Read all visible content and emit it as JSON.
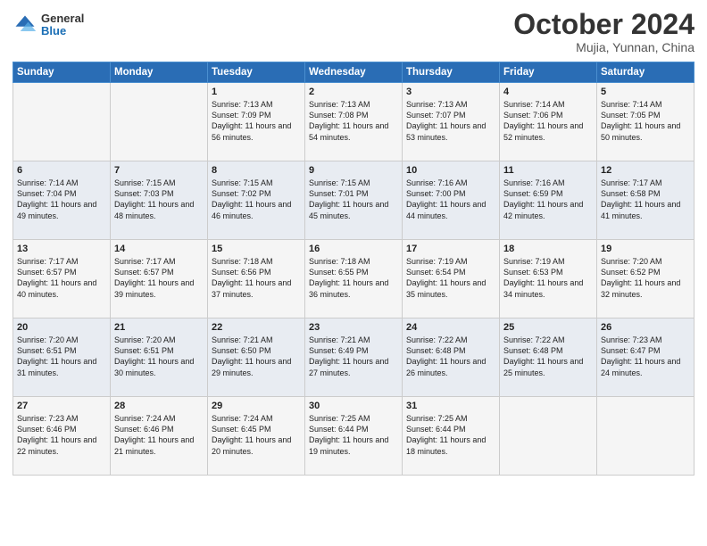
{
  "header": {
    "logo": {
      "general": "General",
      "blue": "Blue"
    },
    "title": "October 2024",
    "location": "Mujia, Yunnan, China"
  },
  "days_of_week": [
    "Sunday",
    "Monday",
    "Tuesday",
    "Wednesday",
    "Thursday",
    "Friday",
    "Saturday"
  ],
  "weeks": [
    [
      {
        "day": "",
        "sunrise": "",
        "sunset": "",
        "daylight": ""
      },
      {
        "day": "",
        "sunrise": "",
        "sunset": "",
        "daylight": ""
      },
      {
        "day": "1",
        "sunrise": "Sunrise: 7:13 AM",
        "sunset": "Sunset: 7:09 PM",
        "daylight": "Daylight: 11 hours and 56 minutes."
      },
      {
        "day": "2",
        "sunrise": "Sunrise: 7:13 AM",
        "sunset": "Sunset: 7:08 PM",
        "daylight": "Daylight: 11 hours and 54 minutes."
      },
      {
        "day": "3",
        "sunrise": "Sunrise: 7:13 AM",
        "sunset": "Sunset: 7:07 PM",
        "daylight": "Daylight: 11 hours and 53 minutes."
      },
      {
        "day": "4",
        "sunrise": "Sunrise: 7:14 AM",
        "sunset": "Sunset: 7:06 PM",
        "daylight": "Daylight: 11 hours and 52 minutes."
      },
      {
        "day": "5",
        "sunrise": "Sunrise: 7:14 AM",
        "sunset": "Sunset: 7:05 PM",
        "daylight": "Daylight: 11 hours and 50 minutes."
      }
    ],
    [
      {
        "day": "6",
        "sunrise": "Sunrise: 7:14 AM",
        "sunset": "Sunset: 7:04 PM",
        "daylight": "Daylight: 11 hours and 49 minutes."
      },
      {
        "day": "7",
        "sunrise": "Sunrise: 7:15 AM",
        "sunset": "Sunset: 7:03 PM",
        "daylight": "Daylight: 11 hours and 48 minutes."
      },
      {
        "day": "8",
        "sunrise": "Sunrise: 7:15 AM",
        "sunset": "Sunset: 7:02 PM",
        "daylight": "Daylight: 11 hours and 46 minutes."
      },
      {
        "day": "9",
        "sunrise": "Sunrise: 7:15 AM",
        "sunset": "Sunset: 7:01 PM",
        "daylight": "Daylight: 11 hours and 45 minutes."
      },
      {
        "day": "10",
        "sunrise": "Sunrise: 7:16 AM",
        "sunset": "Sunset: 7:00 PM",
        "daylight": "Daylight: 11 hours and 44 minutes."
      },
      {
        "day": "11",
        "sunrise": "Sunrise: 7:16 AM",
        "sunset": "Sunset: 6:59 PM",
        "daylight": "Daylight: 11 hours and 42 minutes."
      },
      {
        "day": "12",
        "sunrise": "Sunrise: 7:17 AM",
        "sunset": "Sunset: 6:58 PM",
        "daylight": "Daylight: 11 hours and 41 minutes."
      }
    ],
    [
      {
        "day": "13",
        "sunrise": "Sunrise: 7:17 AM",
        "sunset": "Sunset: 6:57 PM",
        "daylight": "Daylight: 11 hours and 40 minutes."
      },
      {
        "day": "14",
        "sunrise": "Sunrise: 7:17 AM",
        "sunset": "Sunset: 6:57 PM",
        "daylight": "Daylight: 11 hours and 39 minutes."
      },
      {
        "day": "15",
        "sunrise": "Sunrise: 7:18 AM",
        "sunset": "Sunset: 6:56 PM",
        "daylight": "Daylight: 11 hours and 37 minutes."
      },
      {
        "day": "16",
        "sunrise": "Sunrise: 7:18 AM",
        "sunset": "Sunset: 6:55 PM",
        "daylight": "Daylight: 11 hours and 36 minutes."
      },
      {
        "day": "17",
        "sunrise": "Sunrise: 7:19 AM",
        "sunset": "Sunset: 6:54 PM",
        "daylight": "Daylight: 11 hours and 35 minutes."
      },
      {
        "day": "18",
        "sunrise": "Sunrise: 7:19 AM",
        "sunset": "Sunset: 6:53 PM",
        "daylight": "Daylight: 11 hours and 34 minutes."
      },
      {
        "day": "19",
        "sunrise": "Sunrise: 7:20 AM",
        "sunset": "Sunset: 6:52 PM",
        "daylight": "Daylight: 11 hours and 32 minutes."
      }
    ],
    [
      {
        "day": "20",
        "sunrise": "Sunrise: 7:20 AM",
        "sunset": "Sunset: 6:51 PM",
        "daylight": "Daylight: 11 hours and 31 minutes."
      },
      {
        "day": "21",
        "sunrise": "Sunrise: 7:20 AM",
        "sunset": "Sunset: 6:51 PM",
        "daylight": "Daylight: 11 hours and 30 minutes."
      },
      {
        "day": "22",
        "sunrise": "Sunrise: 7:21 AM",
        "sunset": "Sunset: 6:50 PM",
        "daylight": "Daylight: 11 hours and 29 minutes."
      },
      {
        "day": "23",
        "sunrise": "Sunrise: 7:21 AM",
        "sunset": "Sunset: 6:49 PM",
        "daylight": "Daylight: 11 hours and 27 minutes."
      },
      {
        "day": "24",
        "sunrise": "Sunrise: 7:22 AM",
        "sunset": "Sunset: 6:48 PM",
        "daylight": "Daylight: 11 hours and 26 minutes."
      },
      {
        "day": "25",
        "sunrise": "Sunrise: 7:22 AM",
        "sunset": "Sunset: 6:48 PM",
        "daylight": "Daylight: 11 hours and 25 minutes."
      },
      {
        "day": "26",
        "sunrise": "Sunrise: 7:23 AM",
        "sunset": "Sunset: 6:47 PM",
        "daylight": "Daylight: 11 hours and 24 minutes."
      }
    ],
    [
      {
        "day": "27",
        "sunrise": "Sunrise: 7:23 AM",
        "sunset": "Sunset: 6:46 PM",
        "daylight": "Daylight: 11 hours and 22 minutes."
      },
      {
        "day": "28",
        "sunrise": "Sunrise: 7:24 AM",
        "sunset": "Sunset: 6:46 PM",
        "daylight": "Daylight: 11 hours and 21 minutes."
      },
      {
        "day": "29",
        "sunrise": "Sunrise: 7:24 AM",
        "sunset": "Sunset: 6:45 PM",
        "daylight": "Daylight: 11 hours and 20 minutes."
      },
      {
        "day": "30",
        "sunrise": "Sunrise: 7:25 AM",
        "sunset": "Sunset: 6:44 PM",
        "daylight": "Daylight: 11 hours and 19 minutes."
      },
      {
        "day": "31",
        "sunrise": "Sunrise: 7:25 AM",
        "sunset": "Sunset: 6:44 PM",
        "daylight": "Daylight: 11 hours and 18 minutes."
      },
      {
        "day": "",
        "sunrise": "",
        "sunset": "",
        "daylight": ""
      },
      {
        "day": "",
        "sunrise": "",
        "sunset": "",
        "daylight": ""
      }
    ]
  ]
}
